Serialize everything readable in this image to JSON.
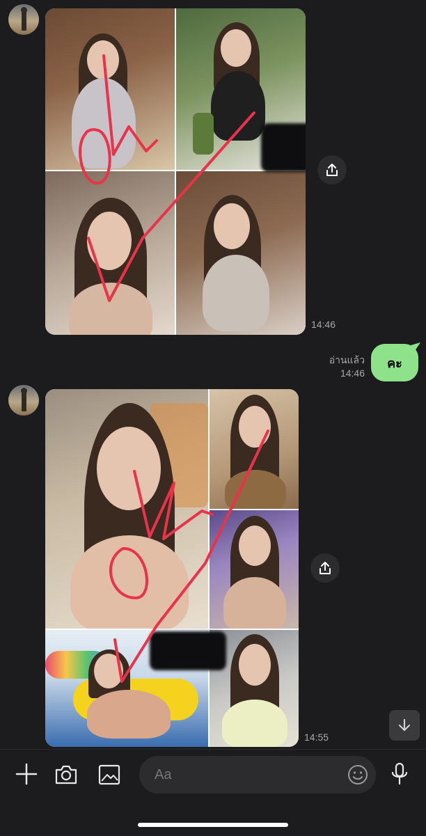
{
  "messages": [
    {
      "type": "photo",
      "sender": "incoming",
      "time": "14:46"
    },
    {
      "type": "text",
      "sender": "outgoing",
      "text": "คะ",
      "read_label": "อ่านแล้ว",
      "time": "14:46"
    },
    {
      "type": "photo",
      "sender": "incoming",
      "time": "14:55"
    }
  ],
  "composer": {
    "placeholder": "Aa"
  },
  "icons": [
    "plus-icon",
    "camera-icon",
    "image-icon",
    "emoji-icon",
    "microphone-icon",
    "share-icon",
    "arrow-down-icon"
  ],
  "colors": {
    "background": "#1c1c1e",
    "outgoing_bubble": "#8de28a",
    "annotation_red": "#e8334a"
  }
}
